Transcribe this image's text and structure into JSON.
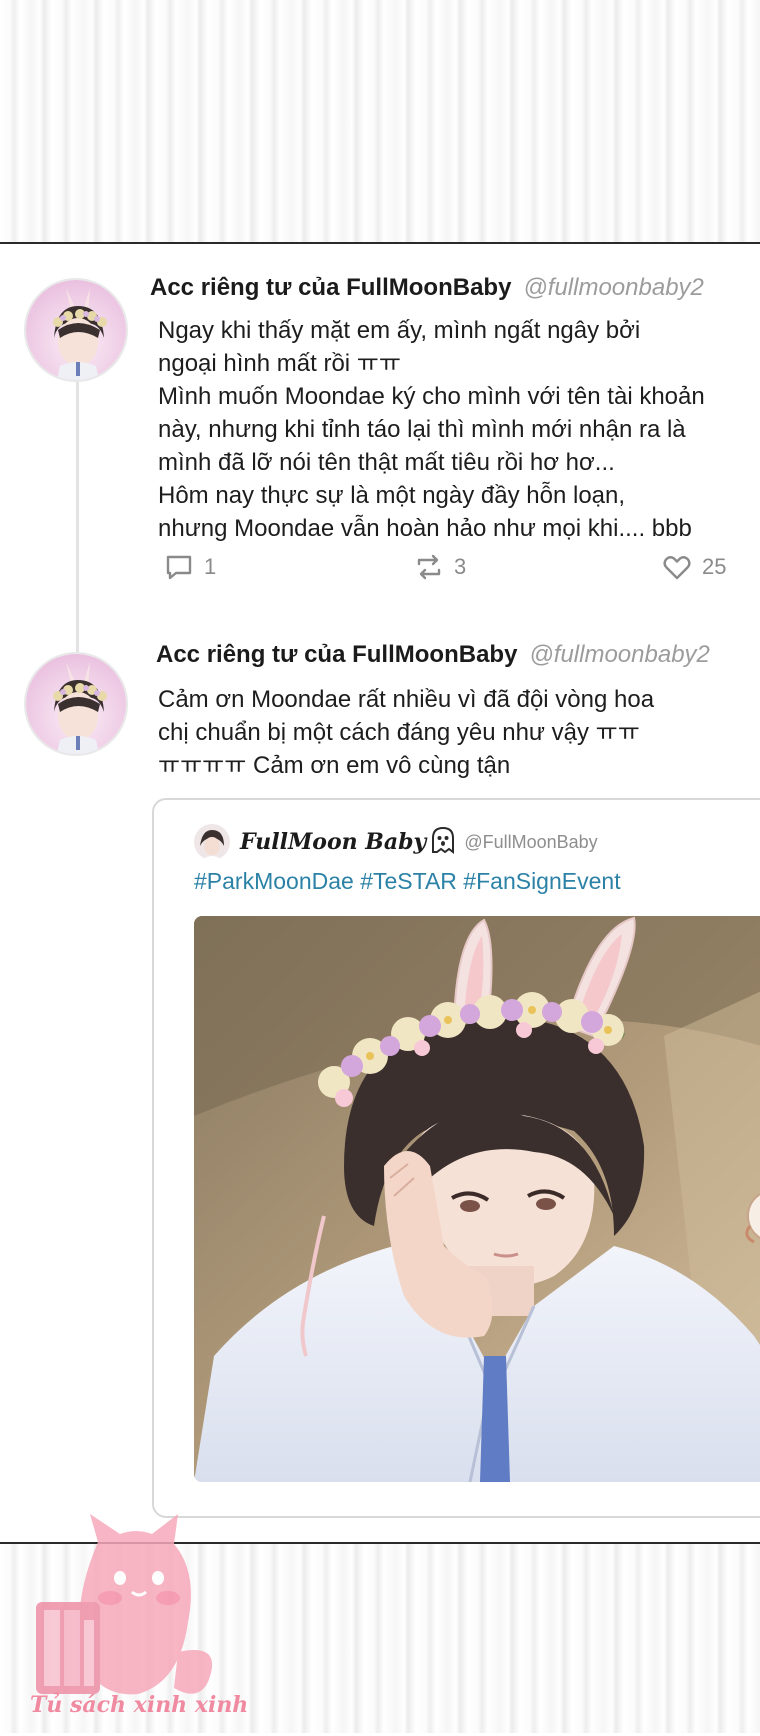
{
  "tweets": [
    {
      "display_name": "Acc riêng tư của FullMoonBaby",
      "handle": "@fullmoonbaby2",
      "text": "Ngay khi thấy mặt em ấy, mình ngất ngây bởi\nngoại hình mất rồi ㅠㅠ\nMình muốn Moondae ký cho mình với tên tài khoản\nnày, nhưng khi tỉnh táo lại thì mình mới nhận ra là\nmình đã lỡ nói tên thật mất tiêu rồi hơ hơ...\nHôm nay thực sự là một ngày đầy hỗn loạn,\nnhưng Moondae vẫn hoàn hảo như mọi khi.... bbb",
      "reply_count": "1",
      "retweet_count": "3",
      "like_count": "25"
    },
    {
      "display_name": "Acc riêng tư của FullMoonBaby",
      "handle": "@fullmoonbaby2",
      "text": "Cảm ơn Moondae rất nhiều vì đã đội vòng hoa\nchị chuẩn bị một cách đáng yêu như vậy ㅠㅠ\nㅠㅠㅠㅠ Cảm ơn em vô cùng tận"
    }
  ],
  "quoted_tweet": {
    "display_name": "FullMoon Baby",
    "handle": "@FullMoonBaby",
    "hashtags": "#ParkMoonDae #TeSTAR #FanSignEvent",
    "image_icon": "photo-boy-with-bunny-ears-and-flower-crown"
  },
  "icons": {
    "reply": "reply-icon",
    "retweet": "retweet-icon",
    "like": "heart-icon",
    "ghost": "ghost-emoji-icon"
  },
  "watermark": {
    "text": "Tủ sách xinh xinh"
  },
  "colors": {
    "hashtag": "#2c82a6",
    "handle": "#9c9c9c",
    "divider": "#2a2a2a",
    "watermark": "#f08aa0"
  }
}
